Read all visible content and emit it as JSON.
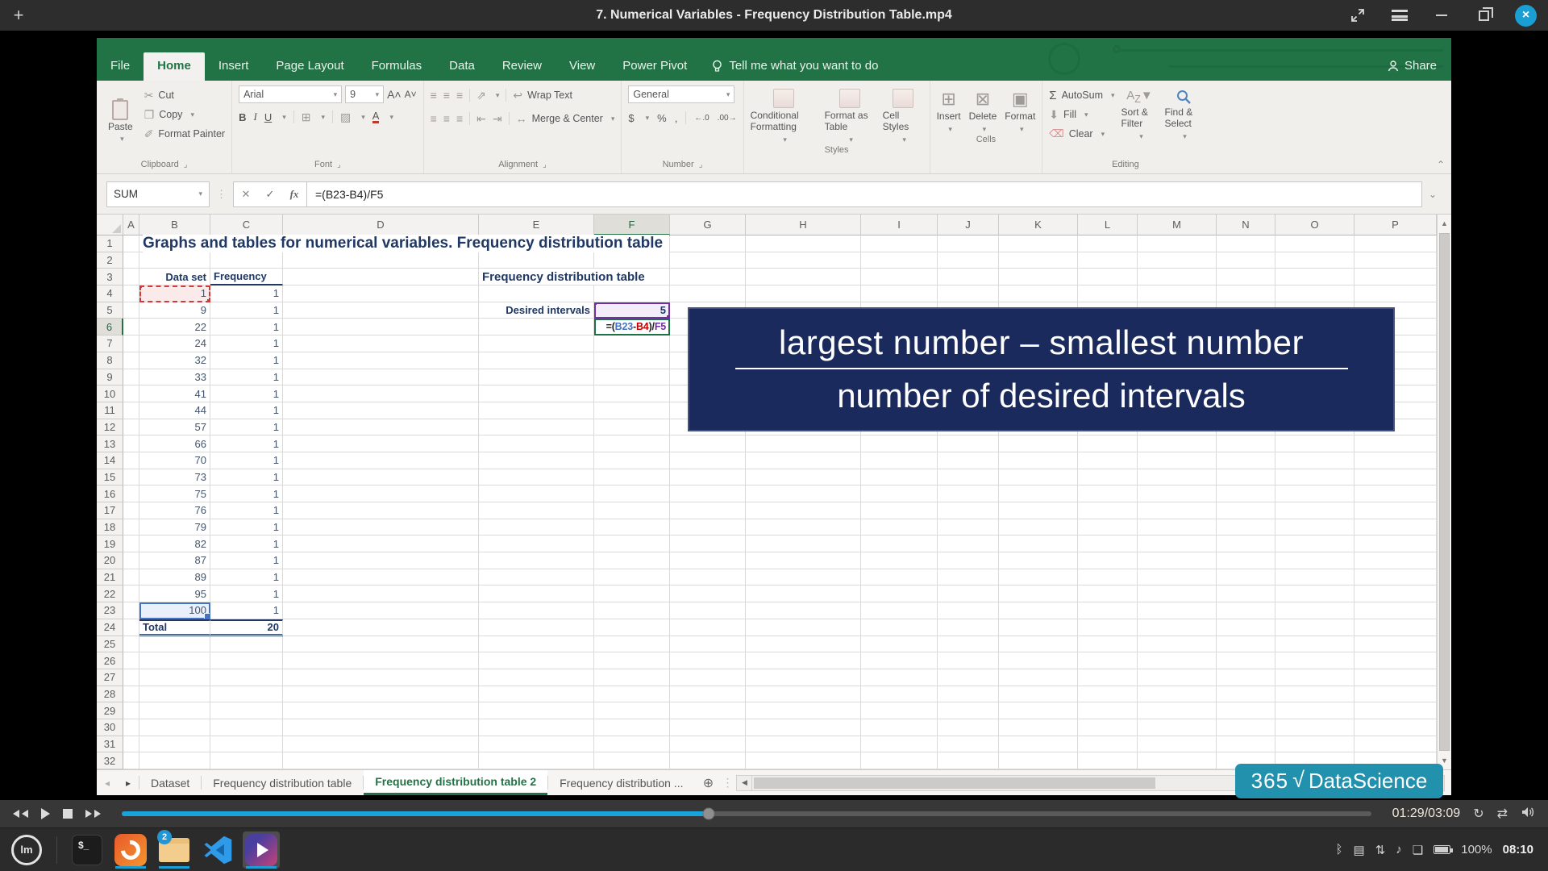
{
  "titlebar": {
    "title": "7. Numerical Variables - Frequency Distribution Table.mp4"
  },
  "ribbon": {
    "tabs": [
      "File",
      "Home",
      "Insert",
      "Page Layout",
      "Formulas",
      "Data",
      "Review",
      "View",
      "Power Pivot"
    ],
    "active_tab": "Home",
    "tell_me": "Tell me what you want to do",
    "share": "Share",
    "clipboard": {
      "label": "Clipboard",
      "paste": "Paste",
      "cut": "Cut",
      "copy": "Copy",
      "format_painter": "Format Painter"
    },
    "font": {
      "label": "Font",
      "family": "Arial",
      "size": "9",
      "bold": "B",
      "italic": "I",
      "underline": "U"
    },
    "alignment": {
      "label": "Alignment",
      "wrap": "Wrap Text",
      "merge": "Merge & Center"
    },
    "number": {
      "label": "Number",
      "format": "General",
      "currency": "$",
      "percent": "%",
      "comma": ",",
      "dec_inc": "←.0",
      "dec_dec": ".00→"
    },
    "styles": {
      "label": "Styles",
      "items": [
        "Conditional Formatting",
        "Format as Table",
        "Cell Styles"
      ]
    },
    "cells": {
      "label": "Cells",
      "items": [
        "Insert",
        "Delete",
        "Format"
      ]
    },
    "editing": {
      "label": "Editing",
      "autosum": "AutoSum",
      "fill": "Fill",
      "clear": "Clear",
      "sort": "Sort & Filter",
      "find": "Find & Select"
    }
  },
  "formula_bar": {
    "name_box": "SUM",
    "formula": "=(B23-B4)/F5"
  },
  "sheet": {
    "columns": [
      "A",
      "B",
      "C",
      "D",
      "E",
      "F",
      "G",
      "H",
      "I",
      "J",
      "K",
      "L",
      "M",
      "N",
      "O",
      "P"
    ],
    "row_count": 32,
    "title": "Graphs and tables for numerical variables. Frequency distribution table",
    "data_header": "Data set",
    "freq_header": "Frequency",
    "dataset": [
      1,
      9,
      22,
      24,
      32,
      33,
      41,
      44,
      57,
      66,
      70,
      73,
      75,
      76,
      79,
      82,
      87,
      89,
      95,
      100
    ],
    "frequencies": [
      1,
      1,
      1,
      1,
      1,
      1,
      1,
      1,
      1,
      1,
      1,
      1,
      1,
      1,
      1,
      1,
      1,
      1,
      1,
      1
    ],
    "total_label": "Total",
    "total_value": "20",
    "fdt_heading": "Frequency distribution table",
    "desired_intervals_label": "Desired intervals",
    "desired_intervals_value": "5",
    "cell_formula_parts": [
      [
        "=(",
        "k"
      ],
      [
        "B23",
        "blue"
      ],
      [
        "-",
        "k"
      ],
      [
        "B4",
        "red"
      ],
      [
        ")/",
        "k"
      ],
      [
        "F5",
        "purple"
      ]
    ],
    "active_col": "F",
    "active_row": 6
  },
  "overlay": {
    "line1": "largest number – smallest number",
    "line2": "number of desired intervals"
  },
  "sheet_tabs": {
    "tabs": [
      "Dataset",
      "Frequency distribution table",
      "Frequency distribution table 2",
      "Frequency distribution ..."
    ],
    "active": "Frequency distribution table 2"
  },
  "logo": {
    "n365": "365",
    "check": "√",
    "dscience": "DataScience"
  },
  "controls": {
    "time": "01:29/03:09",
    "progress_pct": 47
  },
  "taskbar": {
    "badge": "2",
    "battery": "100%",
    "clock": "08:10"
  },
  "colors": {
    "excel_green": "#217346",
    "ref_blue": "#4472c4",
    "ref_red": "#c00000",
    "ref_purple": "#7030a0",
    "overlay_navy": "#1b2a5c",
    "logo_teal": "#2191ad",
    "progress_blue": "#19a3da",
    "navy_text": "#1f3864"
  }
}
